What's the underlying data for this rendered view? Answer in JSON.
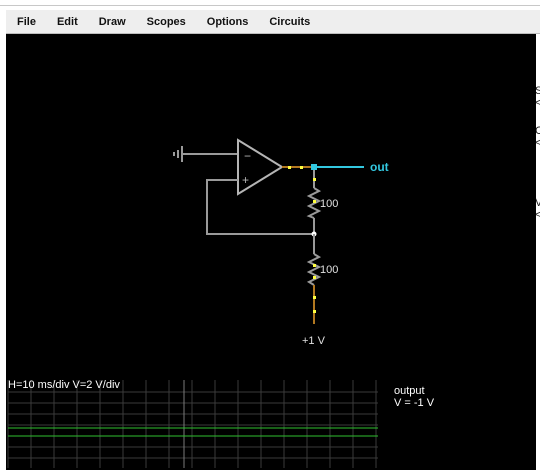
{
  "menu": {
    "file": "File",
    "edit": "Edit",
    "draw": "Draw",
    "scopes": "Scopes",
    "options": "Options",
    "circuits": "Circuits"
  },
  "circuit": {
    "output_label": "out",
    "opamp_minus": "−",
    "opamp_plus": "+",
    "r_top_label": "100",
    "r_bottom_label": "100",
    "supply_label": "+1 V"
  },
  "scope": {
    "scale": "H=10 ms/div V=2 V/div",
    "name": "output",
    "value": "V = -1 V"
  },
  "right_panel": {
    "chars": [
      "S",
      "<",
      "C",
      "<",
      "V",
      "<"
    ]
  },
  "colors": {
    "wire": "#9a9a9a",
    "output_wire": "#33c8e0",
    "current_dot": "#ffff40",
    "scope_trace": "#2fbf2f"
  }
}
